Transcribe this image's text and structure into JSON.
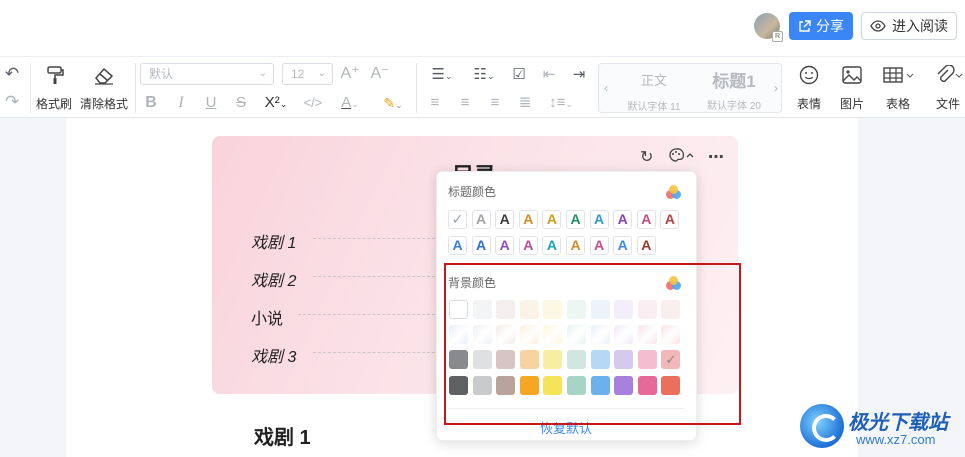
{
  "header": {
    "share_label": "分享",
    "read_label": "进入阅读",
    "avatar_badge": "R"
  },
  "toolbar": {
    "format_painter": "格式刷",
    "clear_format": "清除格式",
    "font_select": "默认",
    "size_select": "12",
    "style_normal": "正文",
    "style_normal_sub": "默认字体 11",
    "style_heading": "标题1",
    "style_heading_sub": "默认字体 20",
    "emoji": "表情",
    "image": "图片",
    "table": "表格",
    "file": "文件"
  },
  "document": {
    "toc_title": "目录",
    "toc_items": [
      "戏剧 1",
      "戏剧 2",
      "小说",
      "戏剧 3"
    ],
    "heading": "戏剧 1"
  },
  "popup": {
    "title_color_label": "标题颜色",
    "bg_color_label": "背景颜色",
    "reset_label": "恢复默认",
    "title_letter": "A",
    "check": "✓",
    "title_colors_row1": [
      "#a0a3a8",
      "#3a3a3a",
      "#d88a1e",
      "#caa21a",
      "#1f8f6a",
      "#2f9cc8",
      "#8a3fb5",
      "#c24b86",
      "#b54444"
    ],
    "title_colors_row2": [
      "#3a7ad6",
      "#2f6fd0",
      "#8c4cc9",
      "#c04a92",
      "#1aa2b8",
      "#d28a2c",
      "#c44e8a",
      "#3a86f7",
      "#9b3a2e"
    ],
    "bg_colors": [
      [
        "#ffffff",
        "#f3f4f6",
        "#f5eeee",
        "#fdf2e6",
        "#fdf8e3",
        "#edf7f1",
        "#edf3fb",
        "#f3eefa",
        "#fbeef3",
        "#fbeeee"
      ],
      [
        "#e8eefb",
        "#eef0f3",
        "#f2ecea",
        "#fcefd9",
        "#fcf6d6",
        "#e7f4ee",
        "#e6f0fb",
        "#efe9f8",
        "#f7e2ea",
        "#f9e4e4"
      ],
      [
        "#888a8e",
        "#dfe0e2",
        "#d6c5c2",
        "#f6d39f",
        "#f9eca3",
        "#cfe7df",
        "#b7d8f5",
        "#d6c9ef",
        "#f4bdd0",
        "#f2b8b8"
      ],
      [
        "#5e6064",
        "#c9cacc",
        "#b9a29c",
        "#f5a623",
        "#f5e35a",
        "#a7d4c6",
        "#6cb1ec",
        "#a77fdc",
        "#e66a97",
        "#ec6f5e"
      ]
    ],
    "selected_bg": "row2-col9"
  },
  "watermark": {
    "name": "极光下载站",
    "url": "www.xz7.com"
  }
}
